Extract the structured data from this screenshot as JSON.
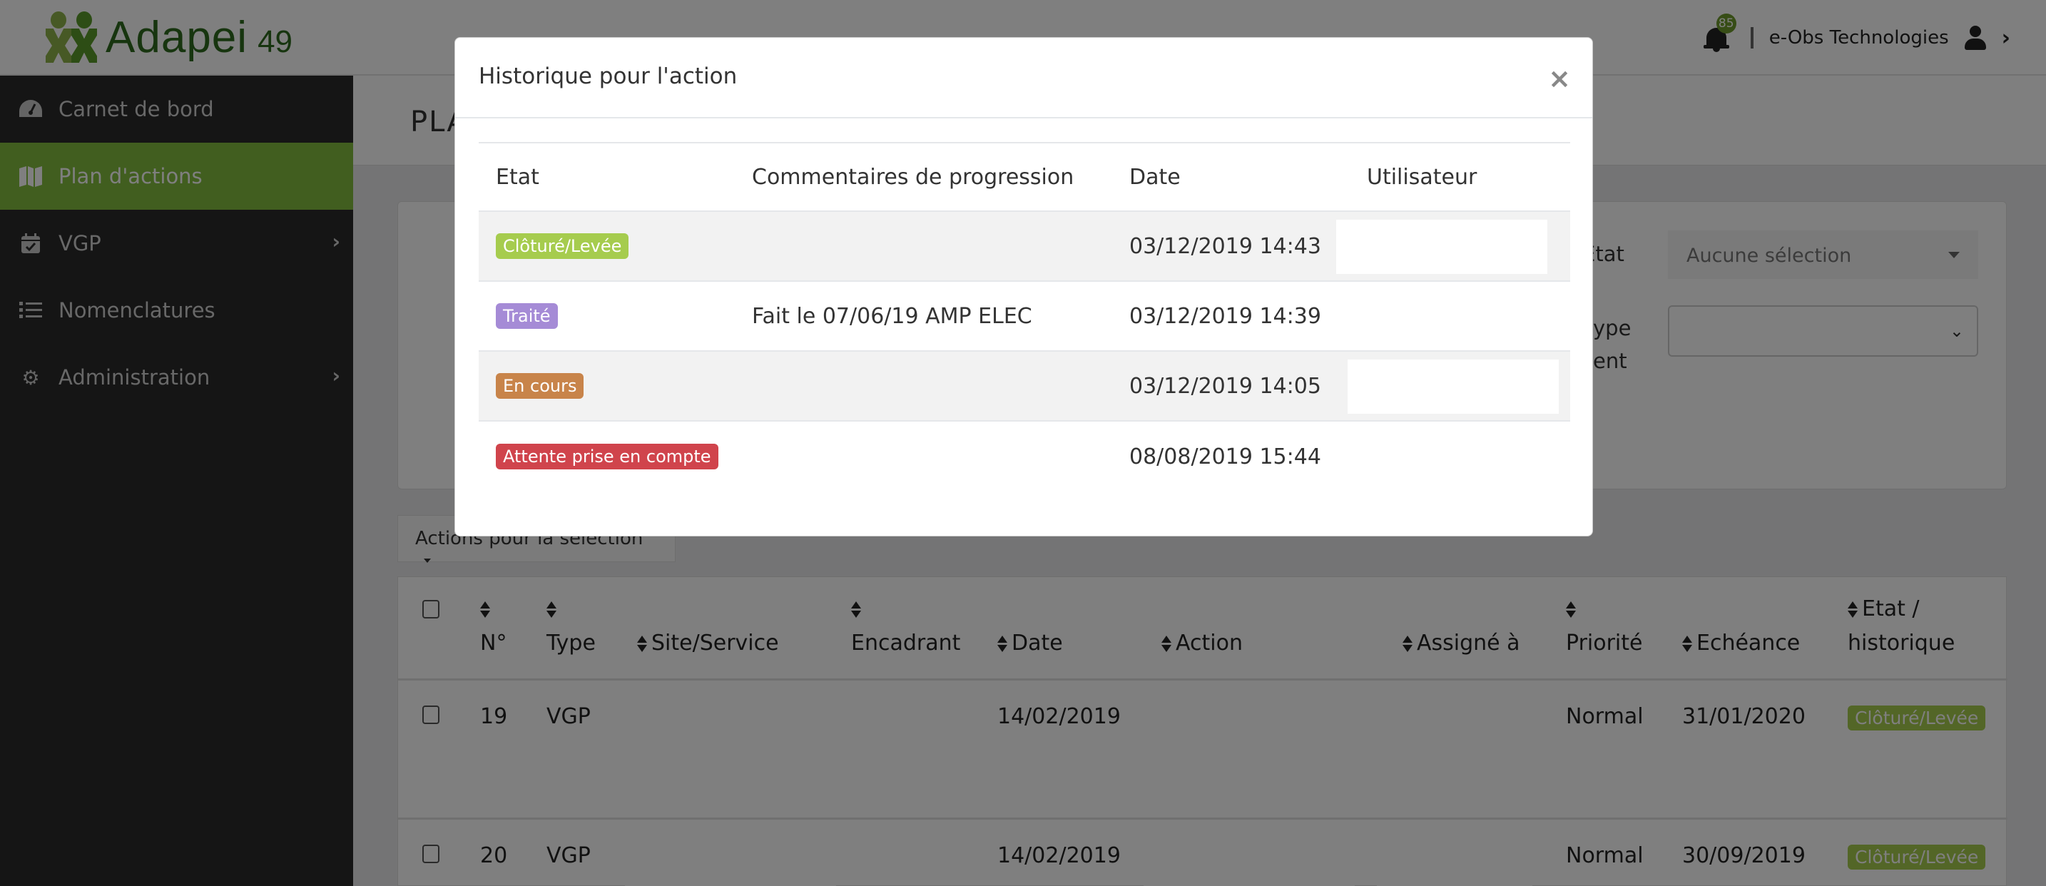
{
  "header": {
    "brand": "Adapei",
    "brand_number": "49",
    "notifications_count": "85",
    "company": "e-Obs Technologies"
  },
  "sidebar": {
    "items": [
      {
        "label": "Carnet de bord",
        "icon": "dashboard-icon",
        "active": false,
        "has_submenu": false
      },
      {
        "label": "Plan d'actions",
        "icon": "map-icon",
        "active": true,
        "has_submenu": false
      },
      {
        "label": "VGP",
        "icon": "calendar-check-icon",
        "active": false,
        "has_submenu": true
      },
      {
        "label": "Nomenclatures",
        "icon": "list-icon",
        "active": false,
        "has_submenu": false
      },
      {
        "label": "Administration",
        "icon": "gear-icon",
        "active": false,
        "has_submenu": true
      }
    ]
  },
  "page": {
    "title_visible": "PLA"
  },
  "filters": {
    "etat_label": "Etat",
    "etat_value": "Aucune sélection",
    "type_label_line1": "ype",
    "type_label_line2": "ent",
    "type_value": ""
  },
  "actions_button": "Actions pour la sélection",
  "table": {
    "columns": [
      "N°",
      "Type",
      "Site/Service",
      "Encadrant",
      "Date",
      "Action",
      "Assigné à",
      "Priorité",
      "Echéance",
      "Etat / historique"
    ],
    "etat_col_line1": "Etat /",
    "etat_col_line2": "historique",
    "rows": [
      {
        "num": "19",
        "type": "VGP",
        "date": "14/02/2019",
        "priority": "Normal",
        "due": "31/01/2020",
        "status": "Clôturé/Levée"
      },
      {
        "num": "20",
        "type": "VGP",
        "date": "14/02/2019",
        "priority": "Normal",
        "due": "30/09/2019",
        "status": "Clôturé/Levée"
      }
    ]
  },
  "modal": {
    "title": "Historique pour l'action",
    "close_label": "×",
    "columns": [
      "Etat",
      "Commentaires de progression",
      "Date",
      "Utilisateur"
    ],
    "rows": [
      {
        "status": "Clôturé/Levée",
        "status_color": "#a6cc4e",
        "comment": "",
        "date": "03/12/2019 14:43",
        "user": ""
      },
      {
        "status": "Traité",
        "status_color": "#a58bd6",
        "comment": "Fait le 07/06/19 AMP ELEC",
        "date": "03/12/2019 14:39",
        "user": ""
      },
      {
        "status": "En cours",
        "status_color": "#c8844a",
        "comment": "",
        "date": "03/12/2019 14:05",
        "user": ""
      },
      {
        "status": "Attente prise en compte",
        "status_color": "#d0444c",
        "comment": "",
        "date": "08/08/2019 15:44",
        "user": ""
      }
    ]
  },
  "colors": {
    "accent": "#83bd3f",
    "sidebar_bg": "#2a2a2a",
    "notification_badge": "#6e9a2c"
  }
}
